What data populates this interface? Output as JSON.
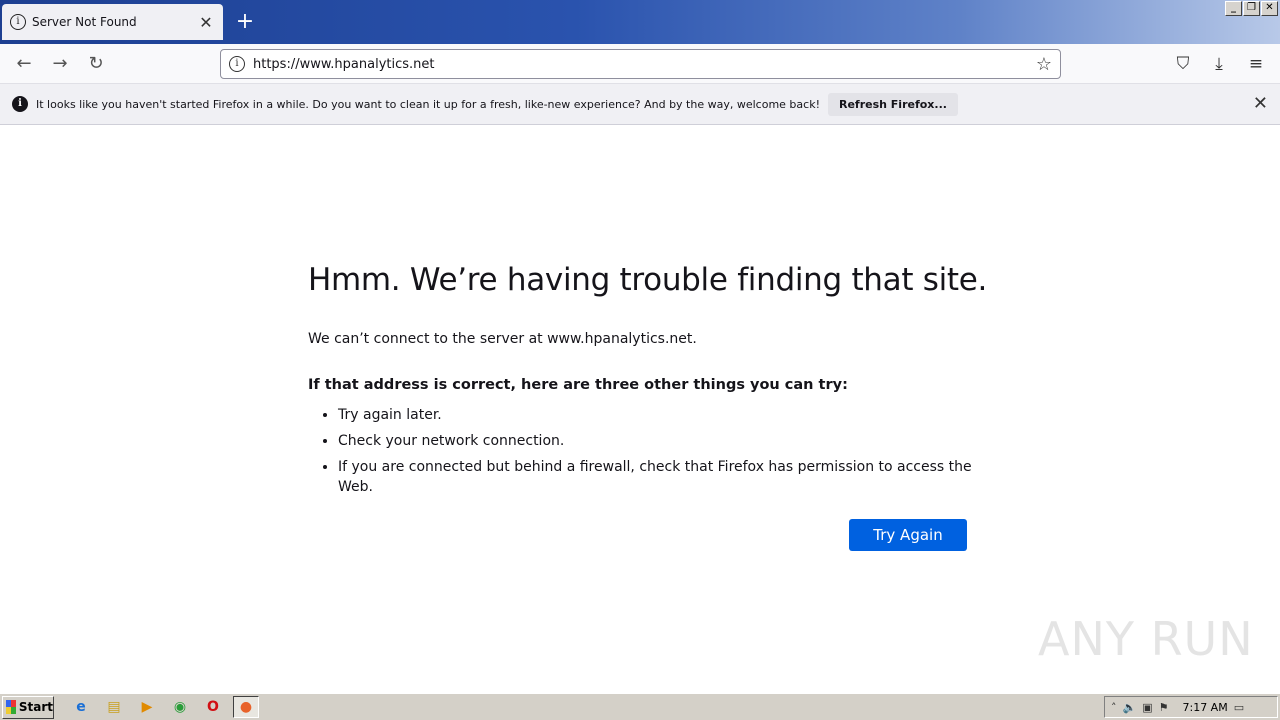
{
  "browser": {
    "tab_title": "Server Not Found",
    "tab_close": "✕",
    "new_tab": "+",
    "url": "https://www.hpanalytics.net"
  },
  "notification": {
    "message": "It looks like you haven't started Firefox in a while. Do you want to clean it up for a fresh, like-new experience? And by the way, welcome back!",
    "button_label": "Refresh Firefox..."
  },
  "error": {
    "title": "Hmm. We’re having trouble finding that site.",
    "description": "We can’t connect to the server at www.hpanalytics.net.",
    "suggestions_heading": "If that address is correct, here are three other things you can try:",
    "suggestions": [
      "Try again later.",
      "Check your network connection.",
      "If you are connected but behind a firewall, check that Firefox has permission to access the Web."
    ],
    "try_again_label": "Try Again"
  },
  "watermark": "ANY RUN",
  "taskbar": {
    "start_label": "Start",
    "clock": "7:17 AM"
  },
  "colors": {
    "accent": "#0061e0",
    "titlebar": "#1d3f91"
  }
}
